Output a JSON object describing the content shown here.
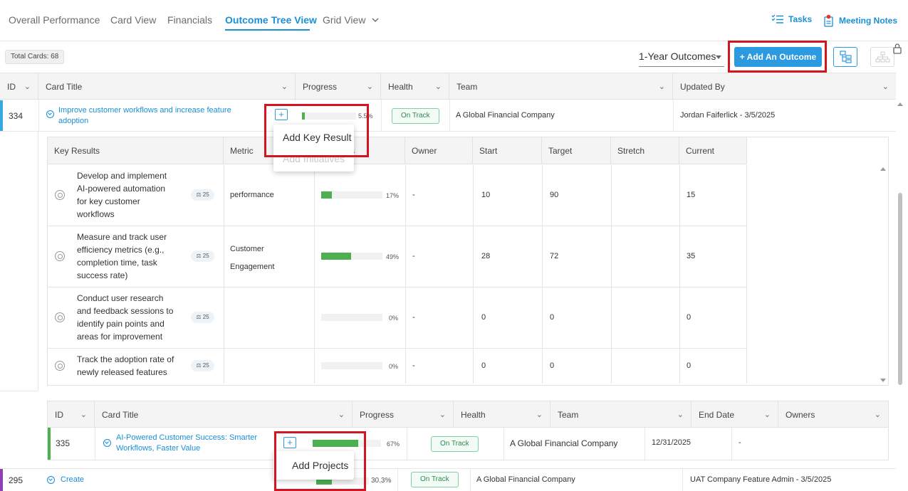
{
  "nav": {
    "tabs": [
      {
        "label": "Overall Performance"
      },
      {
        "label": "Card View"
      },
      {
        "label": "Financials"
      },
      {
        "label": "Outcome Tree View"
      },
      {
        "label": "Grid View"
      }
    ],
    "active_tab": "Outcome Tree View",
    "tasks_label": "Tasks",
    "meeting_notes_label": "Meeting Notes"
  },
  "toolbar": {
    "total_cards": "Total Cards: 68",
    "outcome_period": "1-Year Outcomes",
    "add_outcome_label": "+ Add An Outcome"
  },
  "grid": {
    "columns": [
      "ID",
      "Card Title",
      "Progress",
      "Health",
      "Team",
      "Updated By"
    ],
    "rows": [
      {
        "id": "334",
        "title_line1": "Improve customer workflows and increase feature",
        "title_line2": "adoption",
        "progress": 0.055,
        "progress_label": "5.5%",
        "health": "On Track",
        "team": "A Global Financial Company",
        "updated_by": "Jordan Faiferlick - 3/5/2025",
        "bar_color": "#3aa8e0"
      },
      {
        "id": "295",
        "title": "Create",
        "progress": 0.303,
        "progress_label": "30.3%",
        "health": "On Track",
        "team": "A Global Financial Company",
        "updated_by": "UAT Company Feature Admin - 3/5/2025",
        "bar_color": "#8e3fb5"
      }
    ]
  },
  "card_menu": {
    "items": [
      "Add Key Result",
      "Add Initiatives"
    ]
  },
  "key_results": {
    "columns": [
      "Key Results",
      "Metric",
      "Progress",
      "Owner",
      "Start",
      "Target",
      "Stretch",
      "Current"
    ],
    "rows": [
      {
        "title": "Develop and implement AI-powered automation for key customer workflows",
        "weight": "25",
        "metric": "performance",
        "progress": 0.17,
        "progress_label": "17%",
        "owner": "-",
        "start": "10",
        "target": "90",
        "stretch": "",
        "current": "15"
      },
      {
        "title": "Measure and track user efficiency metrics (e.g., completion time, task success rate)",
        "weight": "25",
        "metric": "Customer Engagement",
        "progress": 0.49,
        "progress_label": "49%",
        "owner": "-",
        "start": "28",
        "target": "72",
        "stretch": "",
        "current": "35"
      },
      {
        "title": "Conduct user research and feedback sessions to identify pain points and areas for improvement",
        "weight": "25",
        "metric": "",
        "progress": 0.0,
        "progress_label": "0%",
        "owner": "-",
        "start": "0",
        "target": "0",
        "stretch": "",
        "current": "0"
      },
      {
        "title": "Track the adoption rate of newly released features",
        "weight": "25",
        "metric": "",
        "progress": 0.0,
        "progress_label": "0%",
        "owner": "-",
        "start": "0",
        "target": "0",
        "stretch": "",
        "current": "0"
      }
    ]
  },
  "projects": {
    "columns": [
      "ID",
      "Card Title",
      "Progress",
      "Health",
      "Team",
      "End Date",
      "Owners"
    ],
    "rows": [
      {
        "id": "335",
        "title_line1": "AI-Powered Customer Success: Smarter",
        "title_line2": "Workflows, Faster Value",
        "progress": 0.67,
        "progress_label": "67%",
        "health": "On Track",
        "team": "A Global Financial Company",
        "end_date": "12/31/2025",
        "owners": "-",
        "bar_color": "#4caf50"
      }
    ]
  },
  "project_menu": {
    "items": [
      "Add Projects"
    ]
  }
}
